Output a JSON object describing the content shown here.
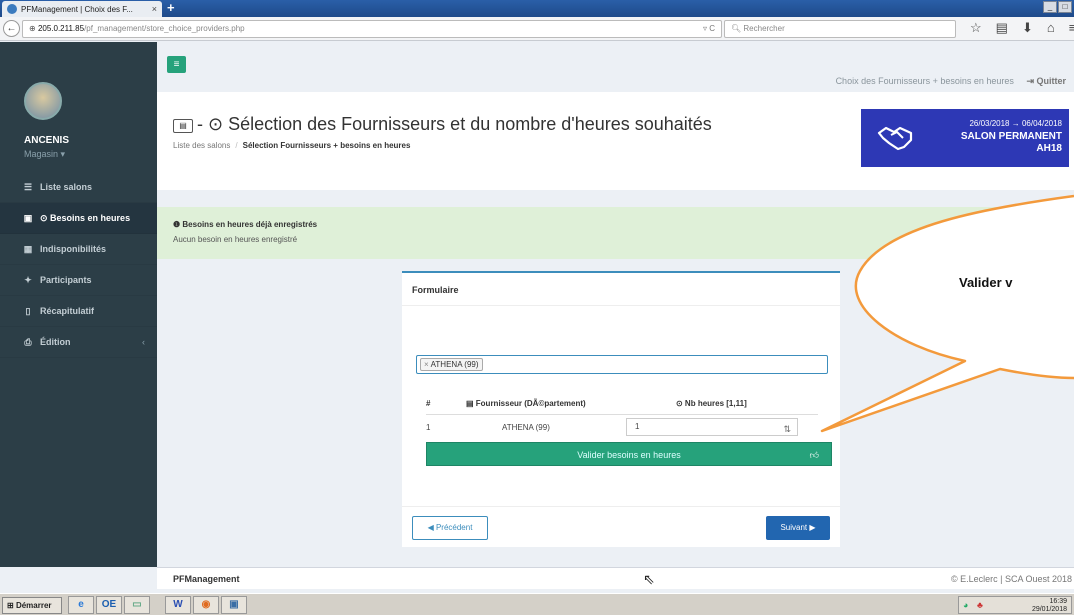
{
  "browser": {
    "tab_title": "PFManagement | Choix des F...",
    "tab_close": "×",
    "new_tab": "+",
    "url_host": "205.0.211.85",
    "url_path": "/pf_management/store_choice_providers.php",
    "search_placeholder": "Rechercher",
    "win_controls": [
      "_",
      "□",
      "×"
    ]
  },
  "sidebar": {
    "user_name": "ANCENIS",
    "user_role": "Magasin ▾",
    "items": [
      {
        "label": "Liste salons",
        "icon": "list-icon"
      },
      {
        "label": "⊙ Besoins en heures",
        "icon": "id-card-icon"
      },
      {
        "label": "Indisponibilités",
        "icon": "calendar-icon"
      },
      {
        "label": "Participants",
        "icon": "users-icon"
      },
      {
        "label": "Récapitulatif",
        "icon": "document-icon"
      },
      {
        "label": "Édition",
        "icon": "print-icon"
      }
    ]
  },
  "topbar": {
    "context": "Choix des Fournisseurs + besoins en heures",
    "quit": "Quitter"
  },
  "header": {
    "title": "- ⊙ Sélection des Fournisseurs et du nombre d'heures souhaités",
    "breadcrumb_home": "Liste des salons",
    "breadcrumb_sep": "/",
    "breadcrumb_current": "Sélection Fournisseurs + besoins en heures"
  },
  "salon": {
    "dates": "26/03/2018 → 06/04/2018",
    "name_line1": "SALON PERMANENT",
    "name_line2": "AH18"
  },
  "alert": {
    "title": "❶ Besoins en heures déjà enregistrés",
    "text": "Aucun besoin en heures enregistré"
  },
  "form": {
    "title": "Formulaire",
    "tag_x": "×",
    "tag_label": "ATHENA (99)",
    "columns": {
      "index": "#",
      "provider": "Fournisseur (DÃ©partement)",
      "hours": "⊙ Nb heures [1,11]"
    },
    "rows": [
      {
        "index": "1",
        "provider": "ATHENA (99)",
        "hours": "1"
      }
    ],
    "submit_label": "Valider besoins en heures",
    "prev_label": "Précédent",
    "next_label": "Suivant"
  },
  "bubble": {
    "text": "Valider v"
  },
  "footer": {
    "left": "PFManagement",
    "right": "© E.Leclerc | SCA Ouest 2018"
  },
  "taskbar": {
    "start": "Démarrer",
    "time": "16:39",
    "date": "29/01/2018"
  },
  "colors": {
    "sidebar": "#2c3e47",
    "accent_green": "#26a27b",
    "salon_blue": "#2d38b5",
    "primary_blue": "#3c8dbc",
    "bubble_stroke": "#f39a3c"
  }
}
